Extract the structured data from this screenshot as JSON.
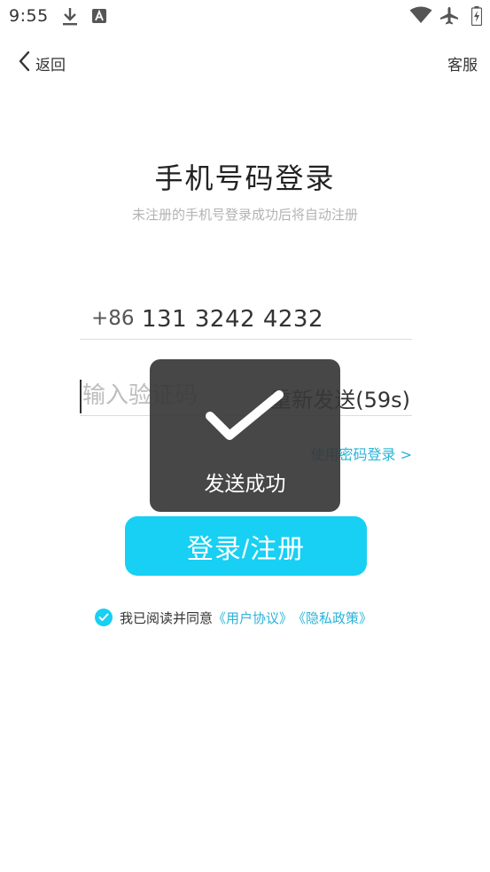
{
  "status_bar": {
    "time": "9:55",
    "icons": [
      "download-icon",
      "a-notification-icon",
      "wifi-icon",
      "airplane-mode-icon",
      "battery-charging-icon"
    ]
  },
  "header": {
    "back_label": "返回",
    "service_label": "客服"
  },
  "title": "手机号码登录",
  "subtitle": "未注册的手机号登录成功后将自动注册",
  "phone": {
    "country_code": "+86",
    "value": "131 3242 4232"
  },
  "code": {
    "placeholder": "输入验证码",
    "value": "",
    "resend_label": "重新发送(59s)"
  },
  "password_login_label": "使用密码登录 >",
  "login_button_label": "登录/注册",
  "agreement": {
    "checked": true,
    "prefix": "我已阅读并同意",
    "user_agreement": "《用户协议》",
    "privacy_policy": "《隐私政策》"
  },
  "toast": {
    "message": "发送成功",
    "icon": "checkmark-icon"
  },
  "colors": {
    "accent": "#17d0f3",
    "link": "#29b4d8",
    "toast_bg": "#373737"
  }
}
